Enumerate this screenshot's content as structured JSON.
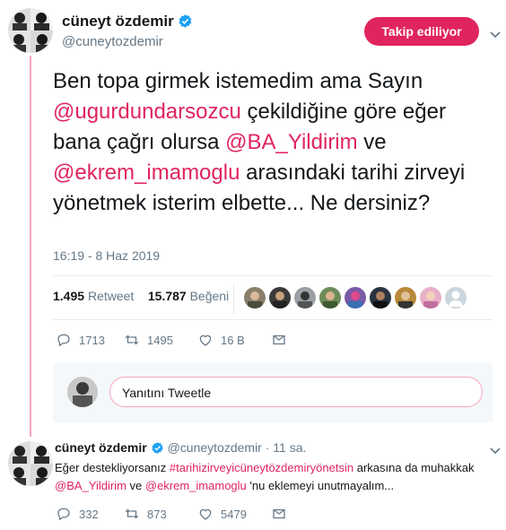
{
  "tweet": {
    "author": {
      "name": "cüneyt özdemir",
      "handle": "@cuneytozdemir",
      "verified": true,
      "avatar": "avatar-grid-photo"
    },
    "follow_button": "Takip ediliyor",
    "text_parts": [
      {
        "text": "Ben topa girmek istemedim ama Sayın ",
        "link": false
      },
      {
        "text": "@ugurdundarsozcu",
        "link": true
      },
      {
        "text": "  çekildiğine göre eğer bana çağrı olursa ",
        "link": false
      },
      {
        "text": "@BA_Yildirim",
        "link": true
      },
      {
        "text": " ve ",
        "link": false
      },
      {
        "text": "@ekrem_imamoglu",
        "link": true
      },
      {
        "text": " arasındaki tarihi zirveyi yönetmek isterim elbette... Ne dersiniz?",
        "link": false
      }
    ],
    "timestamp": "16:19 - 8 Haz 2019",
    "retweets": {
      "count": "1.495",
      "label": "Retweet"
    },
    "likes": {
      "count": "15.787",
      "label": "Beğeni"
    },
    "actions": {
      "reply": "1713",
      "retweet": "1495",
      "like": "16 B"
    }
  },
  "reply_box": {
    "placeholder": "Yanıtını Tweetle"
  },
  "reply_tweet": {
    "author": {
      "name": "cüneyt özdemir",
      "handle": "@cuneytozdemir",
      "time": "· 11 sa."
    },
    "text_parts": [
      {
        "text": "Eğer destekliyorsanız ",
        "link": false
      },
      {
        "text": "#tarihizirveyicüneytözdemiryönetsin",
        "link": true
      },
      {
        "text": " arkasına da muhakkak ",
        "link": false
      },
      {
        "text": "@BA_Yildirim",
        "link": true
      },
      {
        "text": " ve ",
        "link": false
      },
      {
        "text": "@ekrem_imamoglu",
        "link": true
      },
      {
        "text": " 'nu eklemeyi unutmayalım...",
        "link": false
      }
    ],
    "actions": {
      "reply": "332",
      "retweet": "873",
      "like": "5479"
    }
  },
  "colors": {
    "accent": "#e0245e",
    "thread_line": "#f6a4bd",
    "muted": "#657786",
    "verified": "#1da1f2"
  }
}
